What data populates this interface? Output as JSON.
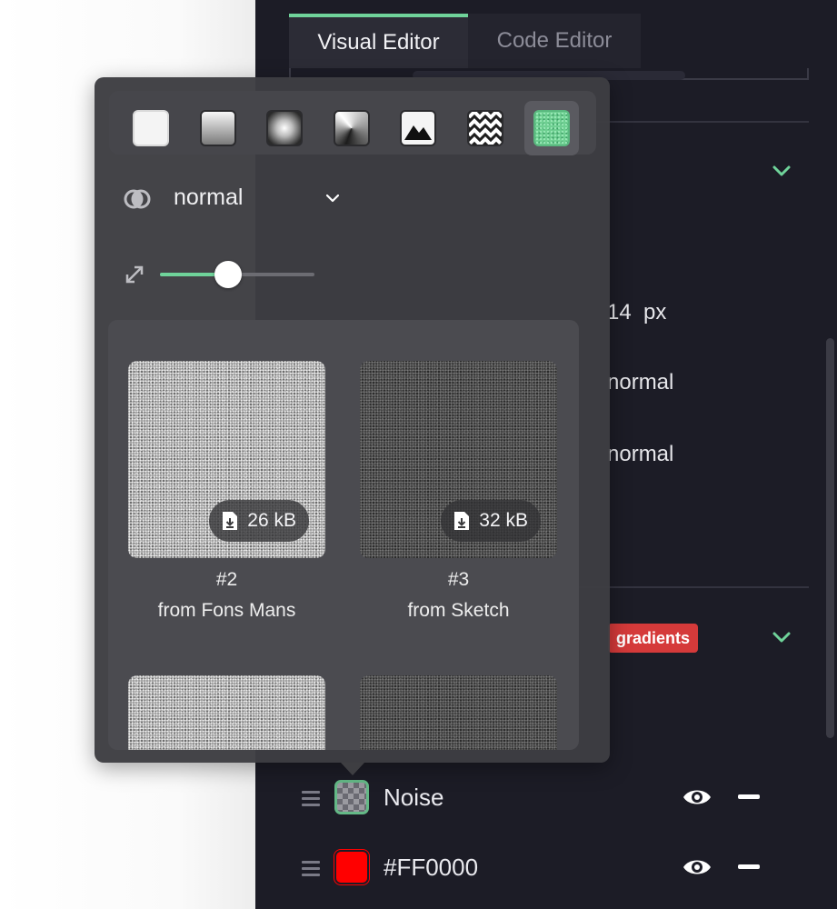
{
  "tabs": [
    {
      "label": "Visual Editor",
      "active": true
    },
    {
      "label": "Code Editor",
      "active": false
    }
  ],
  "properties": {
    "font_size_value": "14",
    "font_size_unit": "px",
    "style_value": "normal",
    "weight_value": "normal",
    "badge": "gradients"
  },
  "popover": {
    "fill_types": [
      {
        "name": "solid-fill",
        "selected": false
      },
      {
        "name": "linear-gradient",
        "selected": false
      },
      {
        "name": "radial-gradient",
        "selected": false
      },
      {
        "name": "angular-gradient",
        "selected": false
      },
      {
        "name": "image-fill",
        "selected": false
      },
      {
        "name": "pattern-fill",
        "selected": false
      },
      {
        "name": "noise-fill",
        "selected": true
      }
    ],
    "blend_mode": "normal",
    "scale_fraction": 0.44,
    "noises": [
      {
        "id": "#2",
        "source": "from Fons Mans",
        "size": "26 kB",
        "tone": "light"
      },
      {
        "id": "#3",
        "source": "from Sketch",
        "size": "32 kB",
        "tone": "dark"
      }
    ]
  },
  "layers": [
    {
      "name": "Noise",
      "swatch": "checker"
    },
    {
      "name": "#FF0000",
      "swatch": "#FF0000"
    }
  ],
  "colors": {
    "accent": "#6FD39A",
    "panel": "#1C1C26",
    "badge": "#D53A3A"
  }
}
